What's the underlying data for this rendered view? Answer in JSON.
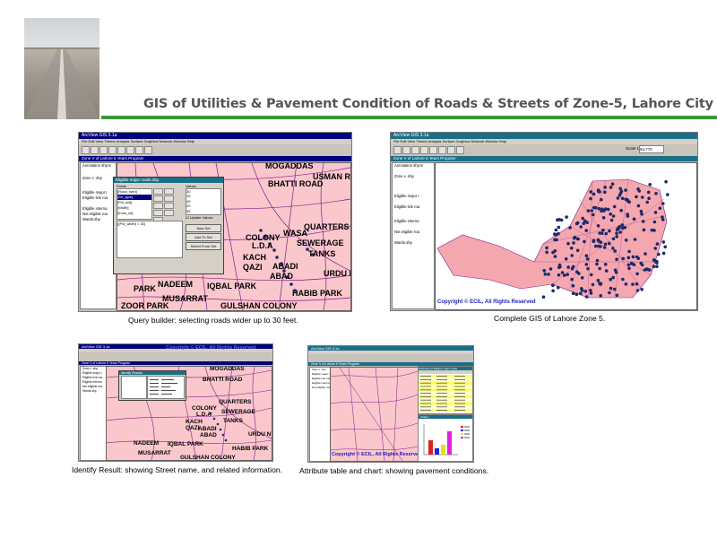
{
  "header": {
    "title": "GIS of Utilities & Pavement Condition of Roads & Streets of Zone-5, Lahore City"
  },
  "app": {
    "window_title": "ArcView GIS 3.1a",
    "menu": "File  Edit  View  Theme  Analysis  Surface  Graphics  Network  Window  Help",
    "view_title": "Zone V of Lahore     5 Years Program",
    "copyright": "Copyright © ECIL, All Rights Reserved",
    "toc_items": [
      "Annotation shp-5",
      "Zone v .shp",
      "Eligible major r",
      "Eligible link roa",
      "Eligible interna",
      "Not eligible roa",
      "Wards.shp"
    ]
  },
  "screens": {
    "query": {
      "map_labels": [
        "MOGADDAS",
        "USMAN RO",
        "BHATTI ROAD",
        "QUARTERS",
        "WASA",
        "COLONY",
        "L.D.A",
        "SEWERAGE",
        "TANKS",
        "KACH",
        "QAZI",
        "ABADI",
        "ABAD",
        "URDU NA",
        "NADEEM",
        "IQBAL PARK",
        "PARK",
        "HABIB PARK",
        "MUSARRAT",
        "GULSHAN COLONY",
        "ZOOR PARK"
      ],
      "dialog": {
        "title": "Eligible major roads.shp",
        "fields_label": "Fields",
        "values_label": "Values",
        "fields": [
          "[Road_nam]",
          "[Str_type]",
          "[Pvt_wid]",
          "[Width]",
          "[Exist_cd]"
        ],
        "values": [
          "30",
          "25",
          "40",
          "20",
          "35"
        ],
        "expression": "([Pvt_width] > 30)",
        "buttons": [
          "New Set",
          "Add To Set",
          "Select From Set"
        ],
        "checkbox": "Update Values"
      },
      "caption": "Query builder: selecting roads wider up to 30 feet."
    },
    "complete": {
      "scale_label": "Scale 1:",
      "scale_value": "64,770",
      "caption": "Complete GIS of Lahore Zone 5."
    },
    "identify": {
      "map_labels": [
        "MOGADDAS",
        "BHATTI ROAD",
        "QUARTERS",
        "COLONY",
        "L.D.A",
        "SEWERAGE",
        "TANKS",
        "KACH",
        "QAZI",
        "ABADI",
        "ABAD",
        "URDU N",
        "NADEEM",
        "IQBAL PARK",
        "HABIB PARK",
        "MUSARRAT",
        "GULSHAN COLONY"
      ],
      "dialog_title": "Identify Results",
      "caption": "Identify Result: showing Street name, and related information."
    },
    "attribute": {
      "table_title": "Attributes of Eligible major roads",
      "chart_title": "Chart1",
      "caption": "Attribute table and chart: showing pavement conditions."
    }
  },
  "colors": {
    "accent_rule": "#3a9a3a",
    "map_fill": "#f9c7cc",
    "road_line": "#8a1a8a",
    "point_marker": "#1a2a6a"
  }
}
